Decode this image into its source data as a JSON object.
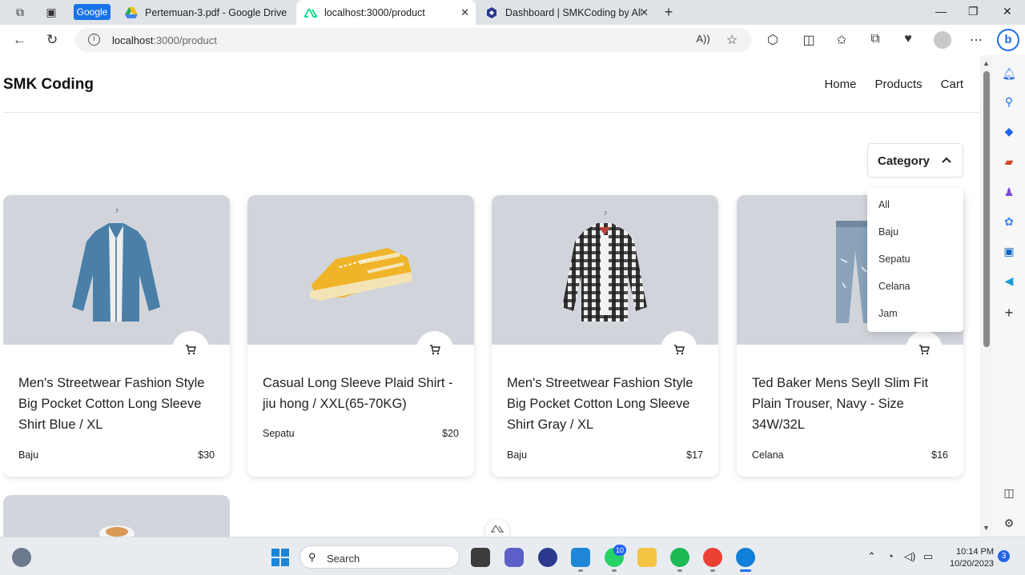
{
  "browser": {
    "tabs": [
      {
        "label": "Google"
      },
      {
        "label": "Pertemuan-3.pdf - Google Drive"
      },
      {
        "label": "localhost:3000/product"
      },
      {
        "label": "Dashboard | SMKCoding by Alkar"
      }
    ],
    "address": {
      "host": "localhost",
      "path": ":3000/product"
    }
  },
  "site": {
    "brand": "SMK Coding",
    "nav": [
      "Home",
      "Products",
      "Cart"
    ],
    "category_label": "Category",
    "category_options": [
      "All",
      "Baju",
      "Sepatu",
      "Celana",
      "Jam"
    ]
  },
  "products": [
    {
      "title": "Men's Streetwear Fashion Style Big Pocket Cotton Long Sleeve Shirt Blue / XL",
      "category": "Baju",
      "price": "$30"
    },
    {
      "title": "Casual Long Sleeve Plaid Shirt - jiu hong / XXL(65-70KG)",
      "category": "Sepatu",
      "price": "$20"
    },
    {
      "title": "Men's Streetwear Fashion Style Big Pocket Cotton Long Sleeve Shirt Gray / XL",
      "category": "Baju",
      "price": "$17"
    },
    {
      "title": "Ted Baker Mens SeylI Slim Fit Plain Trouser, Navy - Size 34W/32L",
      "category": "Celana",
      "price": "$16"
    }
  ],
  "taskbar": {
    "search_placeholder": "Search",
    "whatsapp_badge": "10",
    "time": "10:14 PM",
    "date": "10/20/2023",
    "notifications": "3"
  }
}
